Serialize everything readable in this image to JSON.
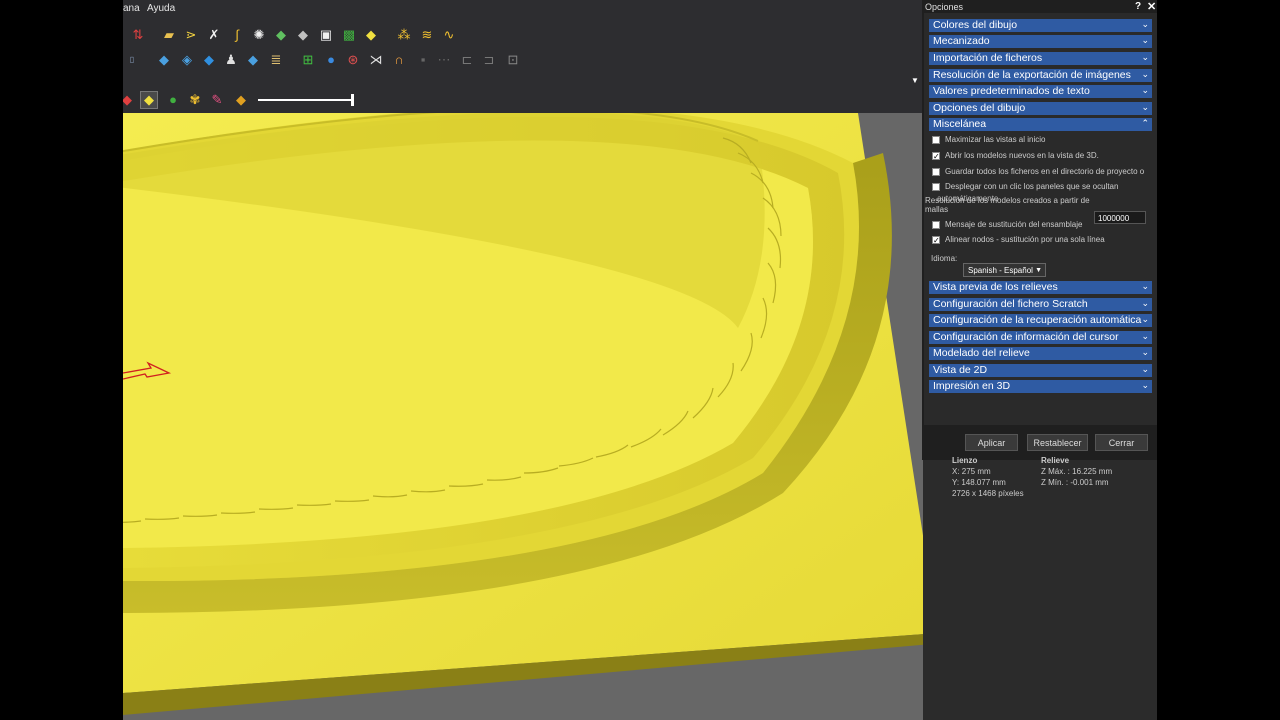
{
  "menubar": {
    "items": [
      "ana",
      "Ayuda"
    ]
  },
  "toolbar": {
    "row1_icons": [
      "order-icon",
      "folder-open-icon",
      "vector-icon",
      "tool-icon",
      "curve-icon",
      "burst-icon",
      "relief-green-icon",
      "relief-grey-icon",
      "frame-icon",
      "layers-icon",
      "relief-yellow-icon",
      "nodes-icon",
      "pattern-icon",
      "wave-icon"
    ],
    "row2_icons": [
      "shape-icon",
      "stack-icon",
      "blue-shape-icon",
      "figure-icon",
      "plate-icon",
      "sandwich-icon",
      "add-green-icon",
      "ink-icon",
      "ring-icon",
      "split-icon",
      "arch-icon",
      "disabled-1-icon",
      "disabled-2-icon",
      "disabled-3-icon",
      "disabled-4-icon",
      "disabled-5-icon"
    ],
    "row3_icons": [
      "shade-icon",
      "yellow-plane-icon",
      "green-blob-icon",
      "paint-icon",
      "multi-color-icon"
    ]
  },
  "panel": {
    "title": "Opciones",
    "help": "?",
    "close": "✕",
    "sections_top": [
      "Colores del dibujo",
      "Mecanizado",
      "Importación de ficheros",
      "Resolución de la exportación de imágenes",
      "Valores predeterminados de texto",
      "Opciones del dibujo",
      "Miscelánea"
    ],
    "misc": {
      "options": [
        {
          "label": "Maximizar las vistas al inicio",
          "checked": false
        },
        {
          "label": "Abrir los modelos nuevos en la vista de 3D.",
          "checked": true
        },
        {
          "label": "Guardar todos los ficheros en el directorio de proyecto o",
          "checked": false
        },
        {
          "label": "Desplegar con un clic los paneles que se ocultan",
          "checked": false
        },
        {
          "label": "Resolución de los modelos creados a partir de mallas",
          "checked": null
        },
        {
          "label": "Mensaje de sustitución del ensamblaje",
          "checked": false
        },
        {
          "label": "Alinear nodos - sustitución por una sola línea",
          "checked": true
        }
      ],
      "overlap_text": "automáticamente",
      "resolution_value": "1000000",
      "language_label": "Idioma:",
      "language_value": "Spanish - Español"
    },
    "sections_bottom": [
      "Vista previa de los relieves",
      "Configuración del fichero Scratch",
      "Configuración de la recuperación automática",
      "Configuración de información del cursor",
      "Modelado del relieve",
      "Vista de 2D",
      "Impresión en 3D"
    ],
    "buttons": {
      "apply": "Aplicar",
      "reset": "Restablecer",
      "close": "Cerrar"
    }
  },
  "status": {
    "canvas_title": "Lienzo",
    "canvas_x": "X: 275 mm",
    "canvas_y": "Y: 148.077 mm",
    "canvas_px": "2726 x 1468 píxeles",
    "relief_title": "Relieve",
    "relief_max": "Z Máx. : 16.225 mm",
    "relief_min": "Z Mín. : -0.001 mm"
  },
  "colors": {
    "relief": "#f0e640",
    "header": "#2f5ba3",
    "background": "#2b2b2b"
  }
}
